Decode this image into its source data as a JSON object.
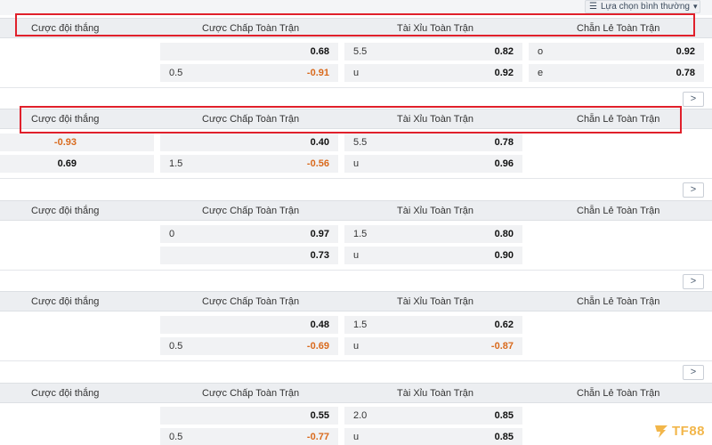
{
  "filter": {
    "label": "Lựa chọn bình thường",
    "icon": "filter-icon"
  },
  "headers": {
    "win": "Cược đội thắng",
    "handicap": "Cược Chấp Toàn Trận",
    "over_under": "Tài Xỉu Toàn Trận",
    "odd_even": "Chẵn Lẻ Toàn Trận"
  },
  "more_label": ">",
  "blocks": [
    {
      "cells": {
        "hc1_l": "",
        "hc1_r": "0.68",
        "hc2_l": "0.5",
        "hc2_r": "-0.91",
        "ou1_l": "5.5",
        "ou1_r": "0.82",
        "ou2_l": "u",
        "ou2_r": "0.92",
        "oe1_l": "o",
        "oe1_r": "0.92",
        "oe2_l": "e",
        "oe2_r": "0.78"
      }
    },
    {
      "cells": {
        "w1_r": "-0.93",
        "w2_r": "0.69",
        "hc1_l": "",
        "hc1_r": "0.40",
        "hc2_l": "1.5",
        "hc2_r": "-0.56",
        "ou1_l": "5.5",
        "ou1_r": "0.78",
        "ou2_l": "u",
        "ou2_r": "0.96"
      }
    },
    {
      "cells": {
        "hc1_l": "0",
        "hc1_r": "0.97",
        "hc2_l": "",
        "hc2_r": "0.73",
        "ou1_l": "1.5",
        "ou1_r": "0.80",
        "ou2_l": "u",
        "ou2_r": "0.90"
      }
    },
    {
      "cells": {
        "hc1_l": "",
        "hc1_r": "0.48",
        "hc2_l": "0.5",
        "hc2_r": "-0.69",
        "ou1_l": "1.5",
        "ou1_r": "0.62",
        "ou2_l": "u",
        "ou2_r": "-0.87"
      }
    },
    {
      "cells": {
        "hc1_l": "",
        "hc1_r": "0.55",
        "hc2_l": "0.5",
        "hc2_r": "-0.77",
        "ou1_l": "2.0",
        "ou1_r": "0.85",
        "ou2_l": "u",
        "ou2_r": "0.85"
      }
    }
  ],
  "logo": {
    "text": "TF88"
  },
  "colors": {
    "negative": "#d96a1d",
    "highlight_box": "#e0202b",
    "header_bg": "#eceef1",
    "cell_bg": "#f1f2f4"
  }
}
